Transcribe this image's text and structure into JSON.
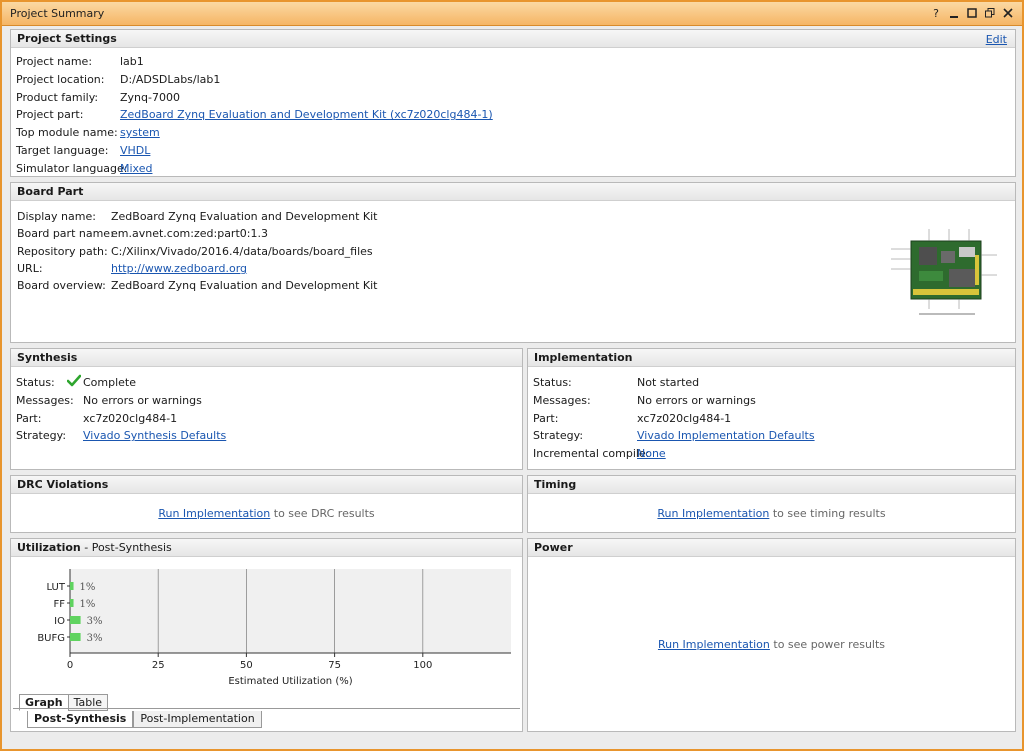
{
  "window": {
    "title": "Project Summary",
    "controls": [
      "?",
      "minimize",
      "restore",
      "maximize",
      "close"
    ]
  },
  "project_settings": {
    "header": "Project Settings",
    "edit": "Edit",
    "rows": [
      {
        "label": "Project name:",
        "value": "lab1",
        "link": false
      },
      {
        "label": "Project location:",
        "value": "D:/ADSDLabs/lab1",
        "link": false
      },
      {
        "label": "Product family:",
        "value": "Zynq-7000",
        "link": false
      },
      {
        "label": "Project part:",
        "value": "ZedBoard Zynq Evaluation and Development Kit (xc7z020clg484-1)",
        "link": true
      },
      {
        "label": "Top module name:",
        "value": "system",
        "link": true
      },
      {
        "label": "Target language:",
        "value": "VHDL",
        "link": true
      },
      {
        "label": "Simulator language:",
        "value": "Mixed",
        "link": true
      }
    ]
  },
  "board_part": {
    "header": "Board Part",
    "rows": [
      {
        "label": "Display name:",
        "value": "ZedBoard Zynq Evaluation and Development Kit",
        "link": false
      },
      {
        "label": "Board part name:",
        "value": "em.avnet.com:zed:part0:1.3",
        "link": false
      },
      {
        "label": "Repository path:",
        "value": "C:/Xilinx/Vivado/2016.4/data/boards/board_files",
        "link": false
      },
      {
        "label": "URL:",
        "value": "http://www.zedboard.org",
        "link": true
      },
      {
        "label": "Board overview:",
        "value": "ZedBoard Zynq Evaluation and Development Kit",
        "link": false
      }
    ]
  },
  "synthesis": {
    "header": "Synthesis",
    "rows": [
      {
        "label": "Status:",
        "value": "Complete",
        "link": false
      },
      {
        "label": "Messages:",
        "value": "No errors or warnings",
        "link": false
      },
      {
        "label": "Part:",
        "value": "xc7z020clg484-1",
        "link": false
      },
      {
        "label": "Strategy:",
        "value": "Vivado Synthesis Defaults",
        "link": true
      }
    ]
  },
  "implementation": {
    "header": "Implementation",
    "rows": [
      {
        "label": "Status:",
        "value": "Not started",
        "link": false
      },
      {
        "label": "Messages:",
        "value": "No errors or warnings",
        "link": false
      },
      {
        "label": "Part:",
        "value": "xc7z020clg484-1",
        "link": false
      },
      {
        "label": "Strategy:",
        "value": "Vivado Implementation Defaults",
        "link": true
      },
      {
        "label": "Incremental compile:",
        "value": "None",
        "link": true
      }
    ]
  },
  "drc": {
    "header": "DRC Violations",
    "link": "Run Implementation",
    "text": " to see DRC results"
  },
  "timing": {
    "header": "Timing",
    "link": "Run Implementation",
    "text": " to see timing results"
  },
  "utilization": {
    "header": "Utilization",
    "subheader": " - Post-Synthesis",
    "tabs": [
      "Graph",
      "Table"
    ],
    "bottom_tabs": [
      "Post-Synthesis",
      "Post-Implementation"
    ]
  },
  "power": {
    "header": "Power",
    "link": "Run Implementation",
    "text": " to see power results"
  },
  "chart_data": {
    "type": "bar",
    "orientation": "horizontal",
    "categories": [
      "LUT",
      "FF",
      "IO",
      "BUFG"
    ],
    "values": [
      1,
      1,
      3,
      3
    ],
    "value_labels": [
      "1%",
      "1%",
      "3%",
      "3%"
    ],
    "xlabel": "Estimated Utilization (%)",
    "xlim": [
      0,
      125
    ],
    "xticks": [
      0,
      25,
      50,
      75,
      100
    ],
    "grid": true,
    "bar_color": "#5fd35f"
  },
  "colors": {
    "accent": "#f2a64a",
    "link": "#1a56b0",
    "check": "#2ea52e"
  }
}
